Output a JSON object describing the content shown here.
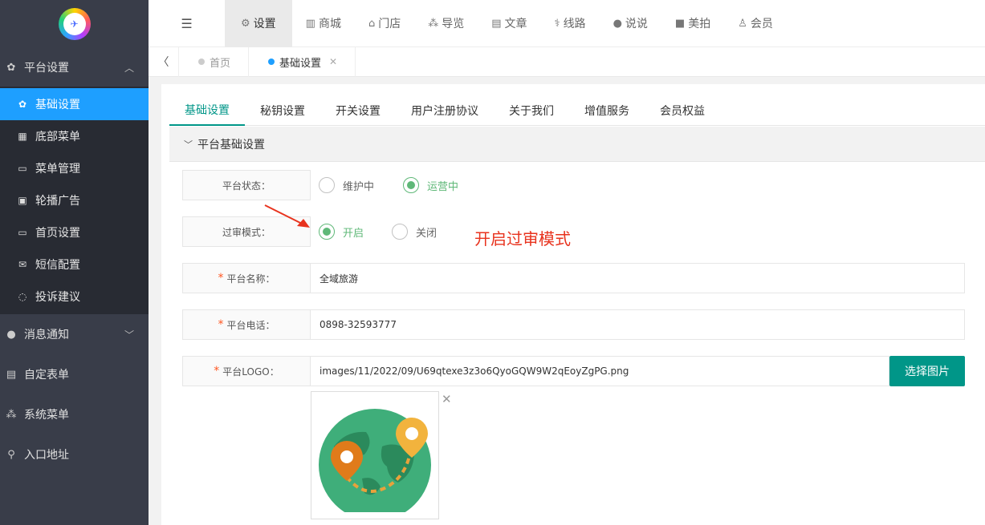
{
  "sidebar": {
    "groups": [
      {
        "label": "平台设置",
        "icon": "gear-icon",
        "expanded": true,
        "items": [
          {
            "label": "基础设置",
            "icon": "gear-icon",
            "active": true
          },
          {
            "label": "底部菜单",
            "icon": "grid-icon"
          },
          {
            "label": "菜单管理",
            "icon": "monitor-icon"
          },
          {
            "label": "轮播广告",
            "icon": "image-icon"
          },
          {
            "label": "首页设置",
            "icon": "monitor-icon"
          },
          {
            "label": "短信配置",
            "icon": "mail-icon"
          },
          {
            "label": "投诉建议",
            "icon": "chat-icon"
          }
        ]
      },
      {
        "label": "消息通知",
        "icon": "chat-icon",
        "expanded": false
      },
      {
        "label": "自定表单",
        "icon": "form-icon"
      },
      {
        "label": "系统菜单",
        "icon": "cubes-icon"
      },
      {
        "label": "入口地址",
        "icon": "search-icon"
      }
    ]
  },
  "topnav": [
    {
      "label": "设置",
      "icon": "gears-icon",
      "active": true
    },
    {
      "label": "商城",
      "icon": "shop-icon"
    },
    {
      "label": "门店",
      "icon": "bank-icon"
    },
    {
      "label": "导览",
      "icon": "cubes-icon"
    },
    {
      "label": "文章",
      "icon": "newspaper-icon"
    },
    {
      "label": "线路",
      "icon": "route-icon"
    },
    {
      "label": "说说",
      "icon": "wechat-icon"
    },
    {
      "label": "美拍",
      "icon": "video-icon"
    },
    {
      "label": "会员",
      "icon": "user-icon"
    }
  ],
  "page_tabs": [
    {
      "label": "首页",
      "active": false
    },
    {
      "label": "基础设置",
      "active": true
    }
  ],
  "content_tabs": [
    "基础设置",
    "秘钥设置",
    "开关设置",
    "用户注册协议",
    "关于我们",
    "增值服务",
    "会员权益"
  ],
  "section_title": "平台基础设置",
  "form": {
    "status_label": "平台状态：",
    "status_options": [
      "维护中",
      "运营中"
    ],
    "review_label": "过审模式：",
    "review_options": [
      "开启",
      "关闭"
    ],
    "name_label": "平台名称：",
    "name_value": "全域旅游",
    "phone_label": "平台电话：",
    "phone_value": "0898-32593777",
    "logo_label": "平台LOGO：",
    "logo_value": "images/11/2022/09/U69qtexe3z3o6QyoGQW9W2qEoyZgPG.png",
    "choose_image_label": "选择图片"
  },
  "annotation": "开启过审模式",
  "colors": {
    "sidebar": "#393d49",
    "active_blue": "#1e9fff",
    "teal": "#009688",
    "green": "#5fb878",
    "annotation_red": "#e8331e"
  }
}
